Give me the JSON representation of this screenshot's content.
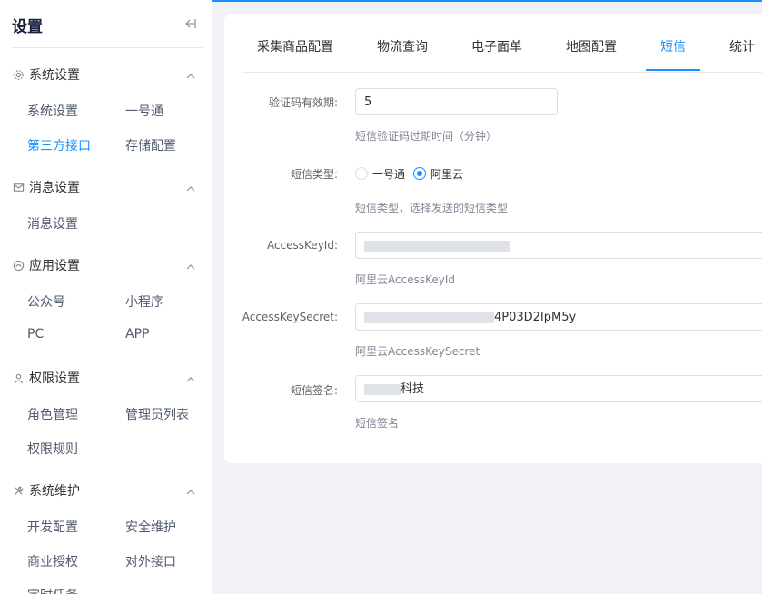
{
  "sidebar": {
    "title": "设置",
    "collapse_icon": "collapse-left-icon",
    "groups": [
      {
        "label": "系统设置",
        "icon": "gear-icon",
        "items": [
          "系统设置",
          "一号通",
          "第三方接口",
          "存储配置"
        ],
        "active": "第三方接口"
      },
      {
        "label": "消息设置",
        "icon": "mail-icon",
        "items": [
          "消息设置"
        ]
      },
      {
        "label": "应用设置",
        "icon": "app-icon",
        "items": [
          "公众号",
          "小程序",
          "PC",
          "APP"
        ]
      },
      {
        "label": "权限设置",
        "icon": "user-icon",
        "items": [
          "角色管理",
          "管理员列表",
          "权限规则"
        ]
      },
      {
        "label": "系统维护",
        "icon": "tools-icon",
        "items": [
          "开发配置",
          "安全维护",
          "商业授权",
          "对外接口",
          "定时任务"
        ]
      }
    ]
  },
  "tabs": [
    "采集商品配置",
    "物流查询",
    "电子面单",
    "地图配置",
    "短信",
    "统计"
  ],
  "active_tab": "短信",
  "form": {
    "code_expiry": {
      "label": "验证码有效期:",
      "value": "5",
      "help": "短信验证码过期时间（分钟）"
    },
    "sms_type": {
      "label": "短信类型:",
      "options": [
        "一号通",
        "阿里云"
      ],
      "selected": "阿里云",
      "help": "短信类型，选择发送的短信类型"
    },
    "access_key_id": {
      "label": "AccessKeyId:",
      "help": "阿里云AccessKeyId"
    },
    "access_key_secret": {
      "label": "AccessKeySecret:",
      "value_visible": "4P03D2IpM5y",
      "help": "阿里云AccessKeySecret"
    },
    "sms_sign": {
      "label": "短信签名:",
      "value_visible": "科技",
      "help": "短信签名"
    }
  },
  "colors": {
    "accent": "#1890ff",
    "page_bg": "#f0f2f5"
  }
}
